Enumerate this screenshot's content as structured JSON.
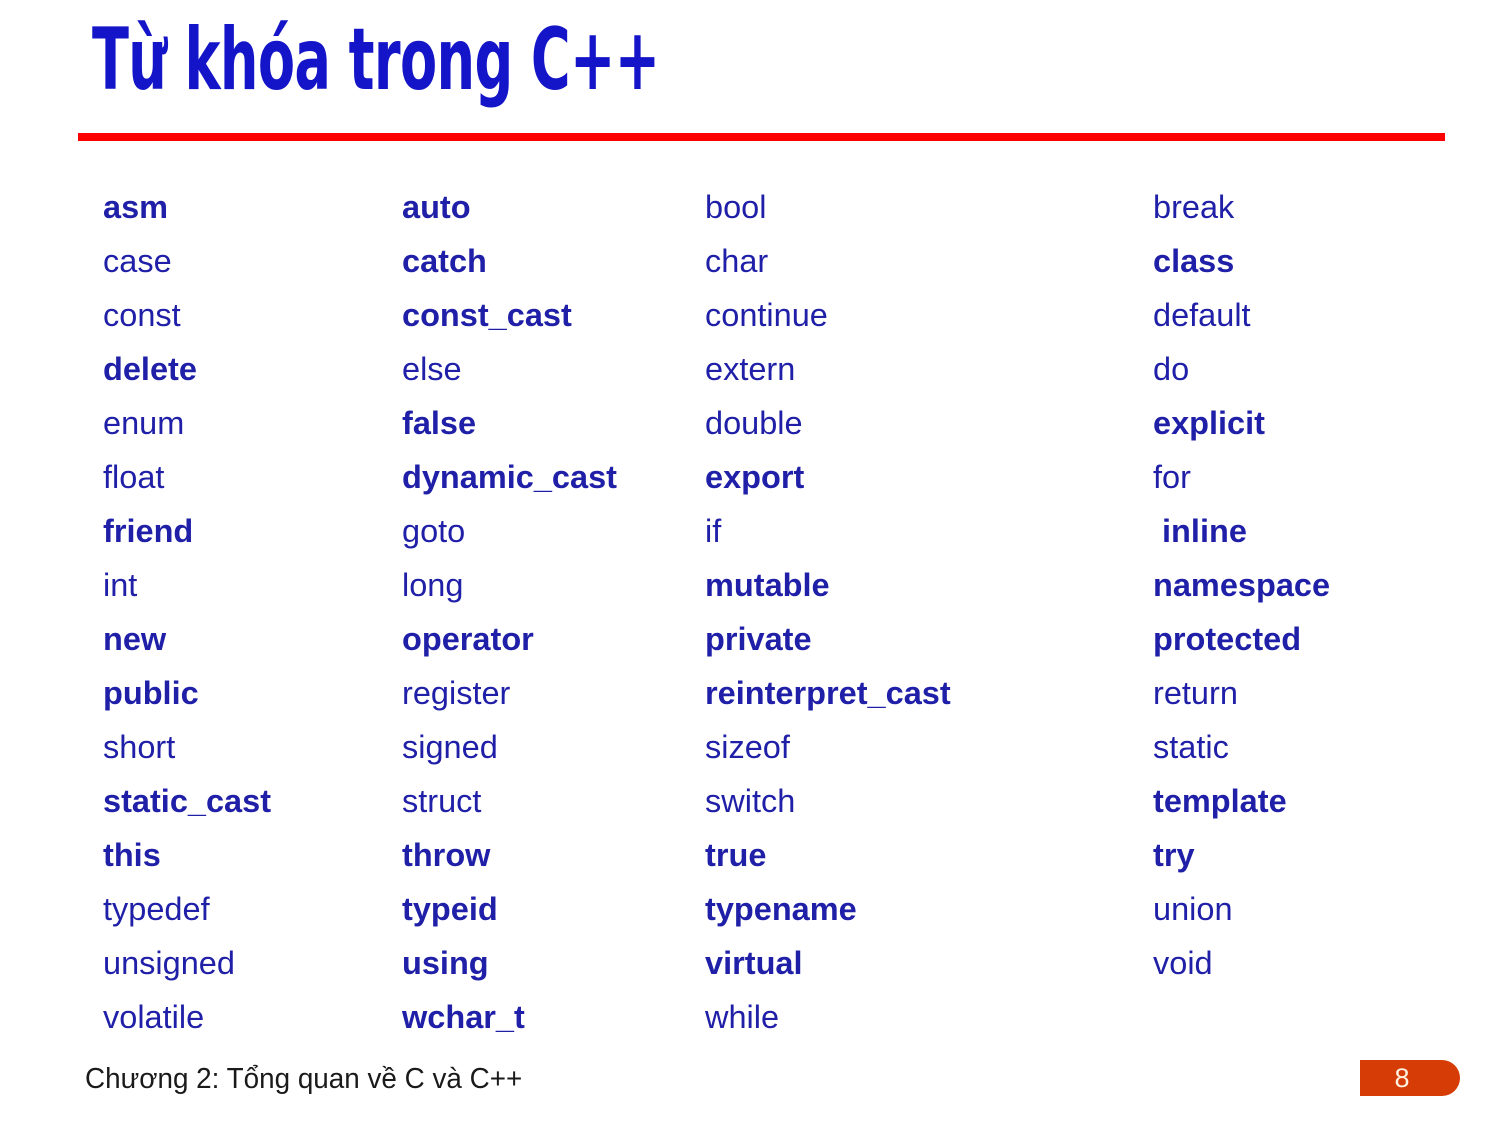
{
  "slide": {
    "title": "Từ khóa trong C++",
    "title_color": "#1414C8",
    "rule_color": "#FE0000",
    "keyword_color": "#1F1FA8",
    "badge_color": "#D63C06"
  },
  "keywords": {
    "columns": [
      {
        "index": 0,
        "cells": [
          {
            "text": "asm",
            "bold": true
          },
          {
            "text": "case",
            "bold": false
          },
          {
            "text": "const",
            "bold": false
          },
          {
            "text": "delete",
            "bold": true
          },
          {
            "text": "enum",
            "bold": false
          },
          {
            "text": "float",
            "bold": false
          },
          {
            "text": "friend",
            "bold": true
          },
          {
            "text": "int",
            "bold": false
          },
          {
            "text": "new",
            "bold": true
          },
          {
            "text": "public",
            "bold": true
          },
          {
            "text": "short",
            "bold": false
          },
          {
            "text": "static_cast",
            "bold": true
          },
          {
            "text": "this",
            "bold": true
          },
          {
            "text": "typedef",
            "bold": false
          },
          {
            "text": "unsigned",
            "bold": false
          },
          {
            "text": "volatile",
            "bold": false
          }
        ]
      },
      {
        "index": 1,
        "cells": [
          {
            "text": "auto",
            "bold": true
          },
          {
            "text": "catch",
            "bold": true
          },
          {
            "text": "const_cast",
            "bold": true
          },
          {
            "text": "else",
            "bold": false
          },
          {
            "text": "false",
            "bold": true
          },
          {
            "text": "dynamic_cast",
            "bold": true
          },
          {
            "text": "goto",
            "bold": false
          },
          {
            "text": "long",
            "bold": false
          },
          {
            "text": "operator",
            "bold": true
          },
          {
            "text": "register",
            "bold": false
          },
          {
            "text": "signed",
            "bold": false
          },
          {
            "text": "struct",
            "bold": false
          },
          {
            "text": "throw",
            "bold": true
          },
          {
            "text": "typeid",
            "bold": true
          },
          {
            "text": "using",
            "bold": true
          },
          {
            "text": "wchar_t",
            "bold": true
          }
        ]
      },
      {
        "index": 2,
        "cells": [
          {
            "text": "bool",
            "bold": false
          },
          {
            "text": "char",
            "bold": false
          },
          {
            "text": "continue",
            "bold": false
          },
          {
            "text": "extern",
            "bold": false
          },
          {
            "text": "double",
            "bold": false
          },
          {
            "text": "export",
            "bold": true
          },
          {
            "text": "if",
            "bold": false
          },
          {
            "text": "mutable",
            "bold": true
          },
          {
            "text": "private",
            "bold": true
          },
          {
            "text": "reinterpret_cast",
            "bold": true
          },
          {
            "text": "sizeof",
            "bold": false
          },
          {
            "text": "switch",
            "bold": false
          },
          {
            "text": "true",
            "bold": true
          },
          {
            "text": "typename",
            "bold": true
          },
          {
            "text": "virtual",
            "bold": true
          },
          {
            "text": "while",
            "bold": false
          }
        ]
      },
      {
        "index": 3,
        "cells": [
          {
            "text": "break",
            "bold": false
          },
          {
            "text": "class",
            "bold": true
          },
          {
            "text": "default",
            "bold": false
          },
          {
            "text": "do",
            "bold": false
          },
          {
            "text": "explicit",
            "bold": true
          },
          {
            "text": "for",
            "bold": false
          },
          {
            "text": " inline",
            "bold": true
          },
          {
            "text": "namespace",
            "bold": true
          },
          {
            "text": "protected",
            "bold": true
          },
          {
            "text": "return",
            "bold": false
          },
          {
            "text": "static",
            "bold": false
          },
          {
            "text": "template",
            "bold": true
          },
          {
            "text": "try",
            "bold": true
          },
          {
            "text": "union",
            "bold": false
          },
          {
            "text": "void",
            "bold": false
          },
          {
            "text": "",
            "bold": false
          }
        ]
      }
    ]
  },
  "footer": {
    "note": "Chương 2: Tổng quan về C và C++",
    "page_number": "8"
  }
}
